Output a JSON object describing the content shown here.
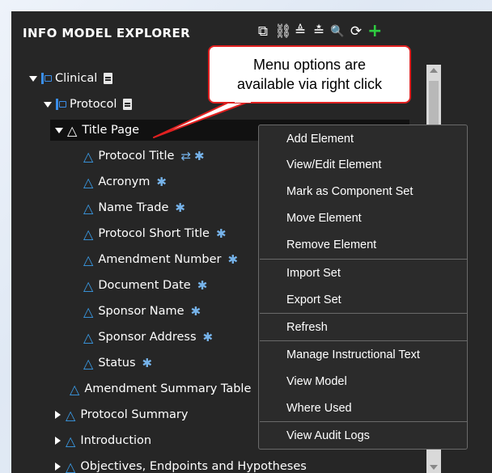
{
  "panel": {
    "title": "INFO MODEL EXPLORER",
    "toolbar": [
      {
        "name": "copy-icon",
        "glyph": "⧉"
      },
      {
        "name": "link-icon",
        "glyph": "⛓"
      },
      {
        "name": "expand-icon",
        "glyph": "≜"
      },
      {
        "name": "collapse-icon",
        "glyph": "≛"
      },
      {
        "name": "search-icon",
        "glyph": "🔍"
      },
      {
        "name": "refresh-icon",
        "glyph": "⟳"
      },
      {
        "name": "add-icon",
        "glyph": "+"
      }
    ]
  },
  "tree": [
    {
      "label": "Clinical"
    },
    {
      "label": "Protocol"
    },
    {
      "label": "Title Page"
    },
    {
      "label": "Protocol Title"
    },
    {
      "label": "Acronym"
    },
    {
      "label": "Name Trade"
    },
    {
      "label": "Protocol Short Title"
    },
    {
      "label": "Amendment Number"
    },
    {
      "label": "Document Date"
    },
    {
      "label": "Sponsor Name"
    },
    {
      "label": "Sponsor Address"
    },
    {
      "label": "Status"
    },
    {
      "label": "Amendment Summary Table"
    },
    {
      "label": "Protocol Summary"
    },
    {
      "label": "Introduction"
    },
    {
      "label": "Objectives, Endpoints and Hypotheses"
    }
  ],
  "callout": {
    "line1": "Menu options are",
    "line2": "available via right click"
  },
  "context_menu": [
    {
      "label": "Add Element"
    },
    {
      "label": "View/Edit Element"
    },
    {
      "label": "Mark as Component Set"
    },
    {
      "label": "Move Element"
    },
    {
      "label": "Remove Element"
    },
    {
      "label": "Import Set"
    },
    {
      "label": "Export Set"
    },
    {
      "label": "Refresh"
    },
    {
      "label": "Manage Instructional Text"
    },
    {
      "label": "View Model"
    },
    {
      "label": "Where Used"
    },
    {
      "label": "View Audit Logs"
    }
  ],
  "colors": {
    "panel_bg": "#262626",
    "accent_blue": "#3a8eea",
    "add_green": "#2ecc40",
    "callout_border": "#e02020"
  }
}
